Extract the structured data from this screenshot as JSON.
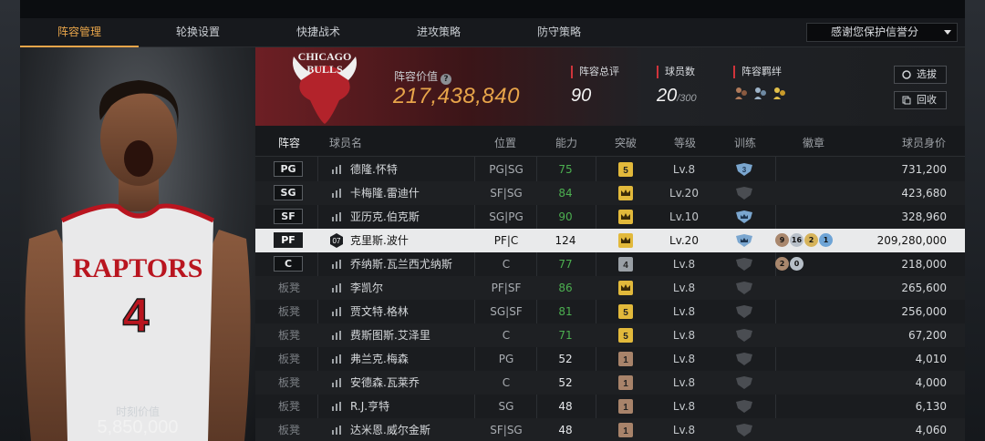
{
  "tabs": [
    "阵容管理",
    "轮换设置",
    "快捷战术",
    "进攻策略",
    "防守策略"
  ],
  "active_tab": 0,
  "dropdown": {
    "value": "感谢您保护信誉分"
  },
  "player_card": {
    "jersey_team": "RAPTORS",
    "jersey_number": "4",
    "value_label": "时刻价值",
    "value": "5,850,000"
  },
  "team": {
    "logo_text_1": "CHICAGO",
    "logo_text_2": "BULLS"
  },
  "lineup": {
    "value_label": "阵容价值",
    "value": "217,438,840",
    "overall_label": "阵容总评",
    "overall": "90",
    "count_label": "球员数",
    "count": "20",
    "count_max": "/300",
    "bond_label": "阵容羁绊"
  },
  "buttons": {
    "select": "选拔",
    "recycle": "回收"
  },
  "columns": {
    "lineup": "阵容",
    "name": "球员名",
    "position": "位置",
    "ability": "能力",
    "breakthrough": "突破",
    "level": "等级",
    "training": "训练",
    "badge": "徽章",
    "price": "球员身价"
  },
  "rows": [
    {
      "slot": "PG",
      "name": "德隆.怀特",
      "pos": "PG|SG",
      "ability": "75",
      "brk": "5",
      "brk_color": "#e2b93b",
      "level": "Lv.8",
      "train": "3",
      "price": "731,200"
    },
    {
      "slot": "SG",
      "name": "卡梅隆.雷迪什",
      "pos": "SF|SG",
      "ability": "84",
      "brk": "crown",
      "brk_color": "#e2b93b",
      "level": "Lv.20",
      "train": "",
      "price": "423,680"
    },
    {
      "slot": "SF",
      "name": "亚历克.伯克斯",
      "pos": "SG|PG",
      "ability": "90",
      "brk": "crown",
      "brk_color": "#e2b93b",
      "level": "Lv.10",
      "train": "crown",
      "price": "328,960"
    },
    {
      "slot": "PF",
      "name": "克里斯.波什",
      "pos": "PF|C",
      "ability": "124",
      "brk": "crown",
      "brk_color": "#e2b93b",
      "level": "Lv.20",
      "train": "crown",
      "price": "209,280,000",
      "jersey": "07",
      "badges": [
        "9",
        "16",
        "2",
        "1"
      ]
    },
    {
      "slot": "C",
      "name": "乔纳斯.瓦兰西尤纳斯",
      "pos": "C",
      "ability": "77",
      "brk": "4",
      "brk_color": "#9aa0a6",
      "level": "Lv.8",
      "train": "",
      "price": "218,000",
      "badges": [
        "2",
        "0"
      ]
    },
    {
      "slot": "板凳",
      "name": "李凯尔",
      "pos": "PF|SF",
      "ability": "86",
      "brk": "crown",
      "brk_color": "#e2b93b",
      "level": "Lv.8",
      "train": "",
      "price": "265,600"
    },
    {
      "slot": "板凳",
      "name": "贾文特.格林",
      "pos": "SG|SF",
      "ability": "81",
      "brk": "5",
      "brk_color": "#e2b93b",
      "level": "Lv.8",
      "train": "",
      "price": "256,000"
    },
    {
      "slot": "板凳",
      "name": "费斯图斯.艾泽里",
      "pos": "C",
      "ability": "71",
      "brk": "5",
      "brk_color": "#e2b93b",
      "level": "Lv.8",
      "train": "",
      "price": "67,200"
    },
    {
      "slot": "板凳",
      "name": "弗兰克.梅森",
      "pos": "PG",
      "ability": "52",
      "brk": "1",
      "brk_color": "#a8836a",
      "level": "Lv.8",
      "train": "",
      "price": "4,010"
    },
    {
      "slot": "板凳",
      "name": "安德森.瓦莱乔",
      "pos": "C",
      "ability": "52",
      "brk": "1",
      "brk_color": "#a8836a",
      "level": "Lv.8",
      "train": "",
      "price": "4,000"
    },
    {
      "slot": "板凳",
      "name": "R.J.亨特",
      "pos": "SG",
      "ability": "48",
      "brk": "1",
      "brk_color": "#a8836a",
      "level": "Lv.8",
      "train": "",
      "price": "6,130"
    },
    {
      "slot": "板凳",
      "name": "达米恩.威尔金斯",
      "pos": "SF|SG",
      "ability": "48",
      "brk": "1",
      "brk_color": "#a8836a",
      "level": "Lv.8",
      "train": "",
      "price": "4,060"
    }
  ],
  "colors": {
    "accent": "#e8a54a",
    "ability_green": "#4caf50",
    "red_marker": "#d0343b",
    "selected_row": "#e9eaeb"
  }
}
